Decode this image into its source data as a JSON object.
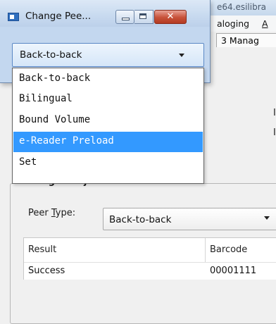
{
  "background": {
    "window_title": "e64.esilibra",
    "menu": [
      "aloging",
      "A"
    ],
    "tab_label": "3 Manag",
    "fragment_1": "I",
    "fragment_2": "I",
    "group_title": "Manage Conjoined Items",
    "peer_type_label": "Peer Type:",
    "peer_type_value": "Back-to-back",
    "table": {
      "columns": [
        "Result",
        "Barcode"
      ],
      "rows": [
        {
          "result": "Success",
          "barcode": "00001111"
        }
      ]
    }
  },
  "dialog": {
    "title": "Change Pee...",
    "close_glyph": "✕",
    "select_value": "Back-to-back",
    "options": [
      {
        "label": "Back-to-back",
        "selected": false
      },
      {
        "label": "Bilingual",
        "selected": false
      },
      {
        "label": "Bound Volume",
        "selected": false
      },
      {
        "label": "e-Reader Preload",
        "selected": true
      },
      {
        "label": "Set",
        "selected": false
      }
    ]
  }
}
